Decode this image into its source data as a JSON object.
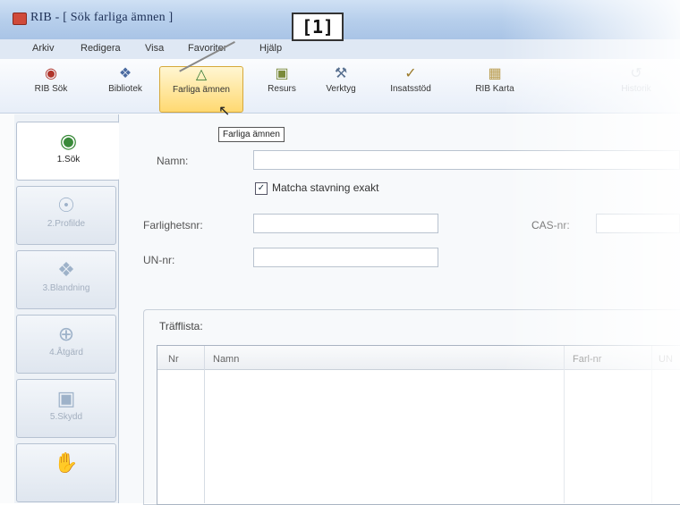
{
  "window": {
    "title": "RIB - [ Sök farliga ämnen ]"
  },
  "callout": {
    "label": "[1]"
  },
  "menu": [
    "Arkiv",
    "Redigera",
    "Visa",
    "Favoriter",
    "Hjälp"
  ],
  "toolbar": {
    "buttons": [
      {
        "label": "RIB Sök",
        "icon": "search-person-icon"
      },
      {
        "label": "Bibliotek",
        "icon": "library-icon"
      },
      {
        "label": "Farliga ämnen",
        "icon": "flask-icon",
        "active": true
      },
      {
        "label": "Resurs",
        "icon": "resource-icon"
      },
      {
        "label": "Verktyg",
        "icon": "tools-icon"
      },
      {
        "label": "Insatsstöd",
        "icon": "clipboard-check-icon"
      },
      {
        "label": "RIB Karta",
        "icon": "map-icon"
      },
      {
        "label": "Historik",
        "icon": "history-icon"
      }
    ],
    "tooltip": "Farliga ämnen"
  },
  "sidebar": {
    "tabs": [
      {
        "label": "1.Sök",
        "selected": true
      },
      {
        "label": "2.Profilde"
      },
      {
        "label": "3.Blandning"
      },
      {
        "label": "4.Åtgärd"
      },
      {
        "label": "5.Skydd"
      },
      {
        "label": ""
      }
    ]
  },
  "form": {
    "name_label": "Namn:",
    "match_label": "Matcha stavning exakt",
    "match_checked": "✓",
    "farlighet_label": "Farlighetsnr:",
    "cas_label": "CAS-nr:",
    "un_label": "UN-nr:"
  },
  "results": {
    "group_label": "Träfflista:",
    "columns": [
      "Nr",
      "Namn",
      "Farl-nr",
      "UN"
    ]
  }
}
